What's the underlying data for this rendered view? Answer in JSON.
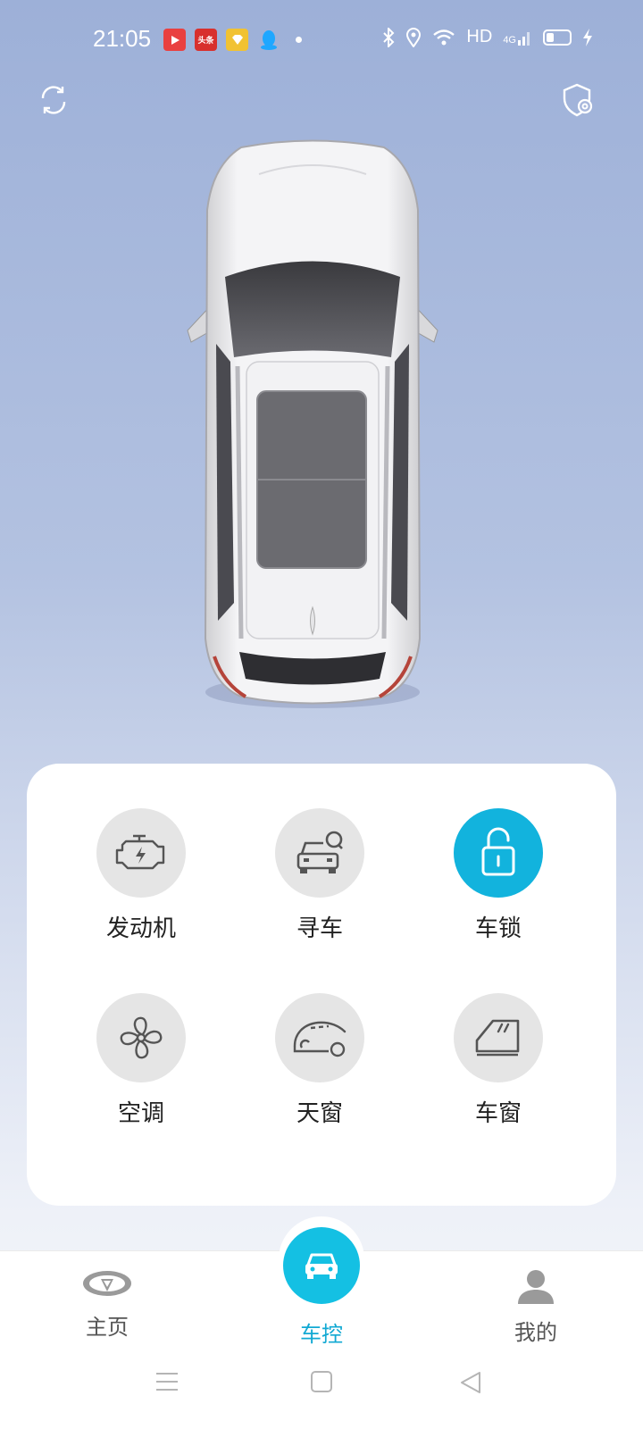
{
  "status_bar": {
    "time": "21:05",
    "notification_icons": [
      "video-app-icon",
      "news-app-icon",
      "gold-app-icon",
      "qq-icon"
    ],
    "toutiao_label": "头条",
    "network_label": "HD",
    "signal_label": "4G"
  },
  "top_bar": {
    "left_icon": "refresh-icon",
    "right_icon": "shield-settings-icon"
  },
  "controls": [
    {
      "label": "发动机",
      "icon": "engine-icon",
      "active": false
    },
    {
      "label": "寻车",
      "icon": "find-car-icon",
      "active": false
    },
    {
      "label": "车锁",
      "icon": "unlock-icon",
      "active": true
    },
    {
      "label": "空调",
      "icon": "fan-icon",
      "active": false
    },
    {
      "label": "天窗",
      "icon": "sunroof-icon",
      "active": false
    },
    {
      "label": "车窗",
      "icon": "window-icon",
      "active": false
    }
  ],
  "bottom_nav": {
    "items": [
      {
        "label": "主页",
        "icon": "brand-logo-icon"
      },
      {
        "label": "车控",
        "icon": "car-icon",
        "active": true
      },
      {
        "label": "我的",
        "icon": "person-icon"
      }
    ]
  },
  "colors": {
    "accent": "#14c0e3",
    "accent_text": "#12a9d3",
    "inactive_circle": "#e5e5e5"
  }
}
